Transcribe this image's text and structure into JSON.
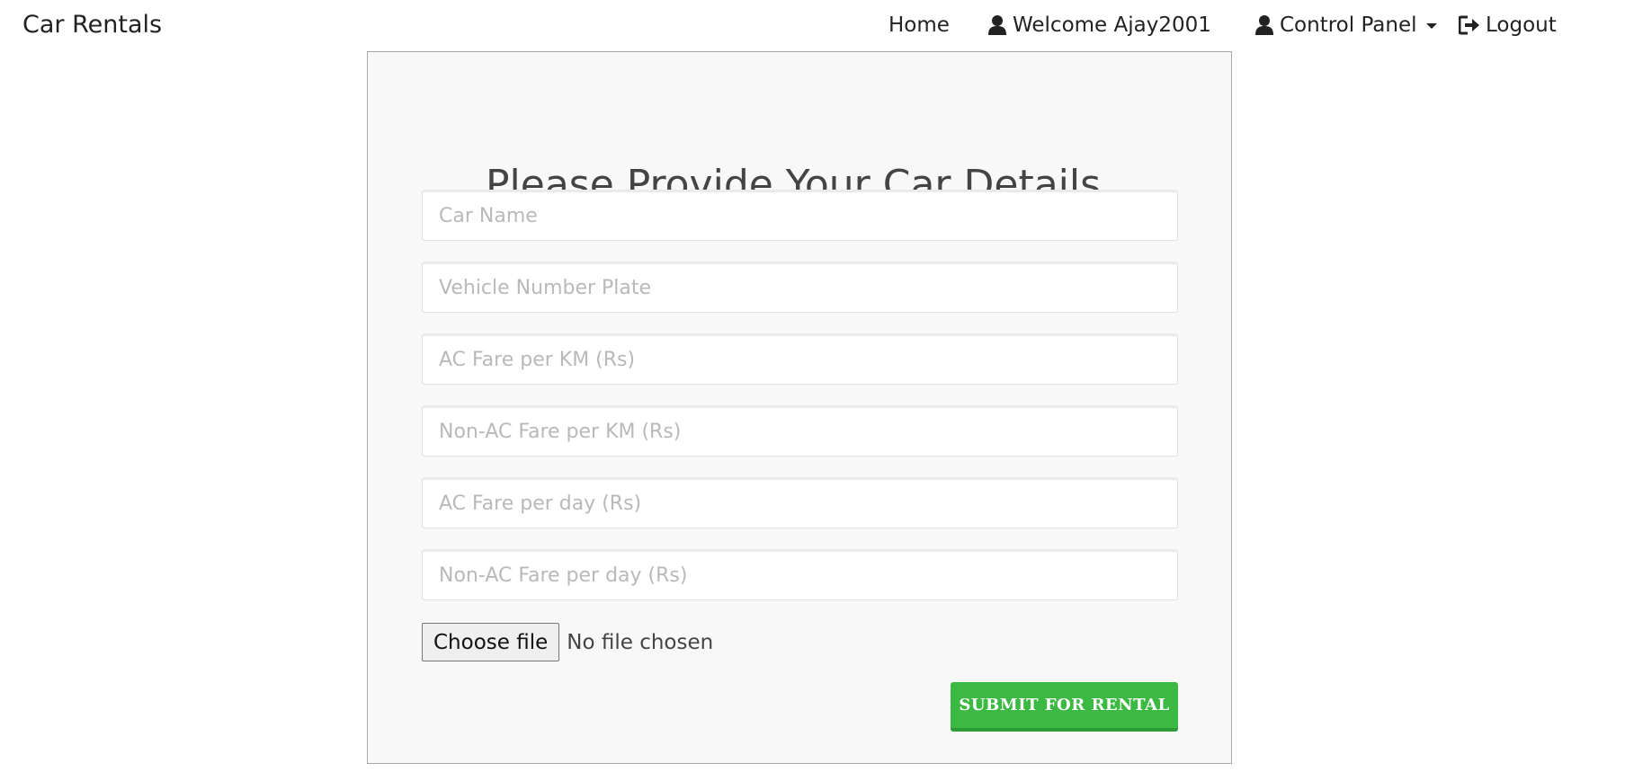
{
  "navbar": {
    "brand": "Car Rentals",
    "home_label": "Home",
    "welcome_label": "Welcome Ajay2001",
    "control_panel_label": "Control Panel",
    "logout_label": "Logout",
    "icons": [
      "user-icon",
      "user-icon",
      "chevron-down-icon",
      "logout-icon"
    ]
  },
  "form": {
    "title": "Please Provide Your Car Details.",
    "fields": {
      "car_name": {
        "placeholder": "Car Name",
        "value": ""
      },
      "vehicle_number_plate": {
        "placeholder": "Vehicle Number Plate",
        "value": ""
      },
      "ac_fare_per_km": {
        "placeholder": "AC Fare per KM (Rs)",
        "value": ""
      },
      "non_ac_fare_per_km": {
        "placeholder": "Non-AC Fare per KM (Rs)",
        "value": ""
      },
      "ac_fare_per_day": {
        "placeholder": "AC Fare per day (Rs)",
        "value": ""
      },
      "non_ac_fare_per_day": {
        "placeholder": "Non-AC Fare per day (Rs)",
        "value": ""
      }
    },
    "file": {
      "button_label": "Choose file",
      "status": "No file chosen"
    },
    "submit_label": "SUBMIT FOR RENTAL"
  },
  "colors": {
    "submit_background": "#3cb943",
    "panel_background": "#f8f8f8",
    "panel_border": "#a8a8a8"
  }
}
